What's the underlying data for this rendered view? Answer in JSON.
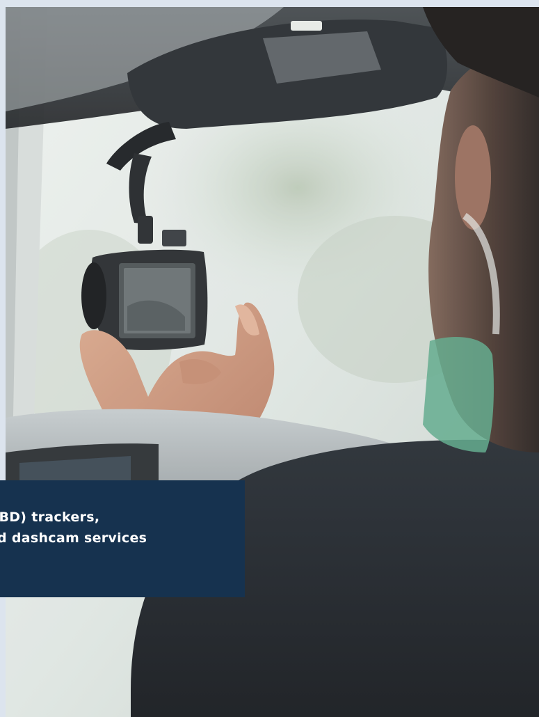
{
  "caption": {
    "line1": "OBD) trackers,",
    "line2": "d dashcam services"
  },
  "colors": {
    "page_background": "#dce4ee",
    "caption_background": "#16324f",
    "caption_text": "#ffffff"
  }
}
